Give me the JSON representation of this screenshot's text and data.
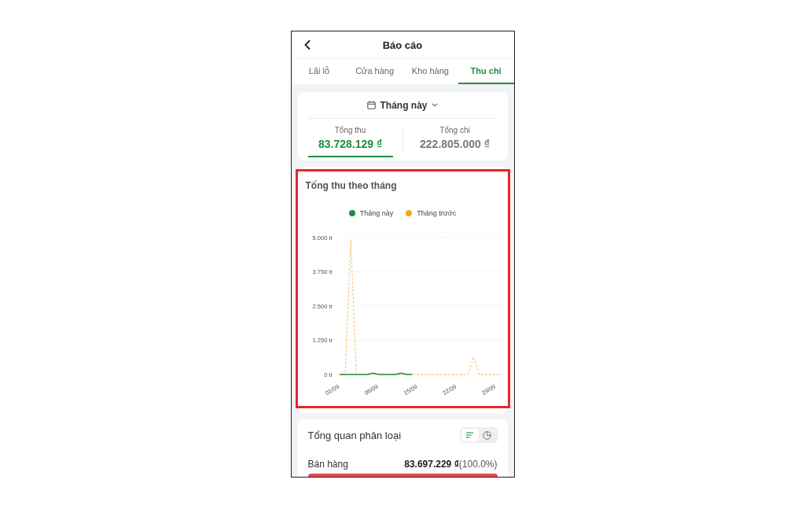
{
  "header": {
    "title": "Báo cáo"
  },
  "tabs": [
    {
      "label": "Lãi lỗ",
      "selected": false
    },
    {
      "label": "Cửa hàng",
      "selected": false
    },
    {
      "label": "Kho hàng",
      "selected": false
    },
    {
      "label": "Thu chi",
      "selected": true
    }
  ],
  "period": {
    "label": "Tháng này"
  },
  "totals": [
    {
      "label": "Tổng thu",
      "value": "83.728.129 ₫",
      "selected": true
    },
    {
      "label": "Tổng chi",
      "value": "222.805.000 ₫",
      "selected": false
    }
  ],
  "revenue_chart": {
    "title": "Tổng thu theo tháng",
    "highlighted": true,
    "chart_data": {
      "type": "line",
      "grid": true,
      "categories": [
        "01/09",
        null,
        null,
        null,
        null,
        null,
        null,
        "08/09",
        null,
        null,
        null,
        null,
        null,
        null,
        "15/09",
        null,
        null,
        null,
        null,
        null,
        null,
        "22/09",
        null,
        null,
        null,
        null,
        null,
        null,
        "29/09",
        null
      ],
      "series": [
        {
          "name": "Tháng này",
          "color": "#1e8e3e",
          "line_style": "solid",
          "values": [
            0,
            0,
            0,
            0,
            0,
            0,
            50,
            0,
            0,
            0,
            0,
            50,
            0,
            0,
            null,
            null,
            null,
            null,
            null,
            null,
            null,
            null,
            null,
            null,
            null,
            null,
            null,
            null,
            null,
            null
          ]
        },
        {
          "name": "Tháng trước",
          "color": "#f5a623",
          "line_style": "dashed",
          "values": [
            0,
            0,
            4900,
            0,
            0,
            0,
            0,
            0,
            0,
            0,
            0,
            0,
            0,
            0,
            0,
            0,
            0,
            0,
            0,
            0,
            0,
            0,
            0,
            0,
            650,
            0,
            0,
            0,
            0,
            0
          ]
        }
      ],
      "yticks": [
        {
          "value": 0,
          "label": "0 tr"
        },
        {
          "value": 1250,
          "label": "1.250 tr"
        },
        {
          "value": 2500,
          "label": "2.500 tr"
        },
        {
          "value": 3750,
          "label": "3.750 tr"
        },
        {
          "value": 5000,
          "label": "5.000 tr"
        }
      ],
      "ylim": [
        0,
        5000
      ]
    }
  },
  "breakdown": {
    "title": "Tổng quan phân loại",
    "view_toggle": [
      {
        "kind": "list",
        "selected": true
      },
      {
        "kind": "pie",
        "selected": false
      }
    ],
    "items": [
      {
        "name": "Bán hàng",
        "amount": "83.697.229 ₫",
        "percent": "(100.0%)",
        "level": 1,
        "color": "#e8474c"
      }
    ]
  }
}
